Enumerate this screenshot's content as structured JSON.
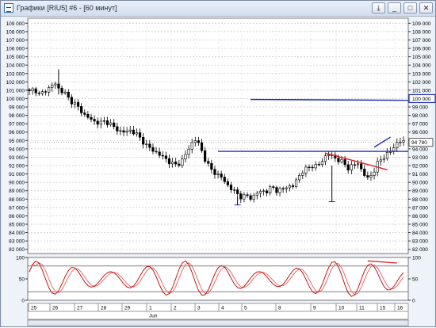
{
  "window": {
    "title": "Графики [RIU5] #6 - [60 минут]",
    "buttons": {
      "pin": "⤓",
      "minimize": "_",
      "maximize": "□",
      "close": "✕"
    }
  },
  "colors": {
    "candle": "#000000",
    "trendline_blue": "#1f2db8",
    "trendline_red": "#e02020",
    "osc_line": "#c00000",
    "osc_signal": "#e06060",
    "highlight_box": "#1f2db8"
  },
  "price_axis": {
    "labels": [
      "109 000",
      "108 000",
      "107 000",
      "106 000",
      "105 000",
      "104 000",
      "103 000",
      "102 000",
      "101 000",
      "100 000",
      "99 000",
      "98 000",
      "97 000",
      "96 000",
      "95 000",
      "94 000",
      "93 000",
      "92 000",
      "91 000",
      "90 000",
      "89 000",
      "88 000",
      "87 000",
      "86 000",
      "85 000",
      "84 000",
      "83 000",
      "82 000"
    ],
    "boxed_label": "100 000",
    "current_price": "94 780"
  },
  "oscillator_axis": {
    "labels": [
      "100",
      "50",
      "0"
    ]
  },
  "time_axis": {
    "days": [
      "25",
      "26",
      "27",
      "28",
      "29",
      "1",
      "2",
      "3",
      "4",
      "5",
      "8",
      "9",
      "10",
      "11",
      "15",
      "16"
    ],
    "month": "Jun"
  },
  "chart_data": {
    "type": "candlestick",
    "ylim": [
      81500,
      109600
    ],
    "close_path": [
      [
        0,
        100800
      ],
      [
        1,
        101200
      ],
      [
        2,
        100400
      ],
      [
        3,
        100900
      ],
      [
        4,
        101300
      ],
      [
        5,
        101900
      ],
      [
        6,
        101000
      ],
      [
        7,
        100700
      ],
      [
        8,
        99800
      ],
      [
        9,
        99400
      ],
      [
        10,
        98700
      ],
      [
        11,
        98000
      ],
      [
        12,
        97600
      ],
      [
        13,
        97200
      ],
      [
        14,
        97100
      ],
      [
        15,
        97300
      ],
      [
        16,
        97000
      ],
      [
        17,
        96400
      ],
      [
        18,
        96100
      ],
      [
        19,
        96000
      ],
      [
        20,
        96200
      ],
      [
        21,
        95900
      ],
      [
        22,
        95200
      ],
      [
        23,
        94500
      ],
      [
        24,
        94000
      ],
      [
        25,
        93600
      ],
      [
        26,
        93200
      ],
      [
        27,
        92800
      ],
      [
        28,
        92300
      ],
      [
        29,
        92100
      ],
      [
        30,
        92400
      ],
      [
        31,
        93400
      ],
      [
        32,
        94600
      ],
      [
        33,
        95200
      ],
      [
        34,
        93900
      ],
      [
        35,
        92400
      ],
      [
        36,
        91500
      ],
      [
        37,
        91000
      ],
      [
        38,
        90600
      ],
      [
        39,
        89800
      ],
      [
        40,
        89200
      ],
      [
        41,
        88700
      ],
      [
        42,
        88200
      ],
      [
        43,
        88400
      ],
      [
        44,
        88100
      ],
      [
        45,
        88700
      ],
      [
        46,
        89000
      ],
      [
        47,
        88900
      ],
      [
        48,
        89500
      ],
      [
        49,
        89000
      ],
      [
        50,
        89100
      ],
      [
        51,
        89600
      ],
      [
        52,
        89400
      ],
      [
        53,
        90500
      ],
      [
        54,
        91300
      ],
      [
        55,
        91700
      ],
      [
        56,
        92000
      ],
      [
        57,
        91900
      ],
      [
        58,
        92700
      ],
      [
        59,
        93400
      ],
      [
        60,
        93100
      ],
      [
        61,
        92700
      ],
      [
        62,
        92400
      ],
      [
        63,
        91700
      ],
      [
        64,
        92000
      ],
      [
        65,
        92300
      ],
      [
        66,
        91100
      ],
      [
        67,
        90400
      ],
      [
        68,
        91200
      ],
      [
        69,
        92400
      ],
      [
        70,
        93000
      ],
      [
        71,
        93500
      ],
      [
        72,
        94100
      ],
      [
        73,
        95000
      ],
      [
        74,
        94800
      ]
    ],
    "trendlines": [
      {
        "color": "blue",
        "from": [
          68,
          99900
        ],
        "to": [
          115,
          99800
        ]
      },
      {
        "color": "blue",
        "from": [
          58,
          93700
        ],
        "to": [
          115,
          93700
        ]
      },
      {
        "color": "red",
        "from": [
          91,
          93500
        ],
        "to": [
          110,
          91500
        ]
      },
      {
        "color": "blue",
        "from": [
          106,
          94200
        ],
        "to": [
          111,
          95400
        ]
      }
    ],
    "oscillator": {
      "levels": [
        80,
        20
      ],
      "ylim": [
        0,
        100
      ]
    }
  }
}
